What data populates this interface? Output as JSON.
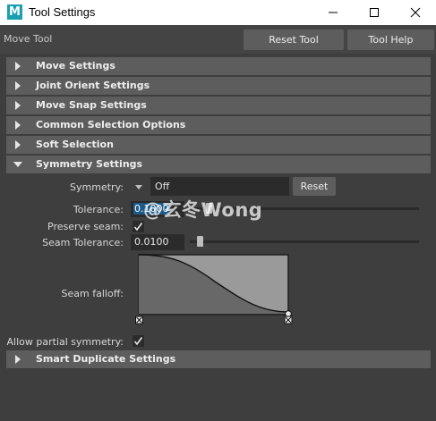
{
  "window": {
    "app_icon": "M",
    "title": "Tool Settings",
    "controls": [
      "minimize-icon",
      "maximize-icon",
      "close-icon"
    ]
  },
  "toolbar": {
    "tool_name": "Move Tool",
    "reset_label": "Reset Tool",
    "help_label": "Tool Help"
  },
  "sections": {
    "move_settings": "Move Settings",
    "joint_orient": "Joint Orient Settings",
    "move_snap": "Move Snap Settings",
    "common_selection": "Common Selection Options",
    "soft_selection": "Soft Selection",
    "symmetry": "Symmetry Settings",
    "smart_duplicate": "Smart Duplicate Settings"
  },
  "symmetry": {
    "symmetry_label": "Symmetry:",
    "symmetry_value": "Off",
    "reset_label": "Reset",
    "tolerance_label": "Tolerance:",
    "tolerance_value": "0.1000",
    "tolerance_slider_fraction": 0.07,
    "preserve_seam_label": "Preserve seam:",
    "preserve_seam_checked": true,
    "seam_tolerance_label": "Seam Tolerance:",
    "seam_tolerance_value": "0.0100",
    "seam_tolerance_slider_fraction": 0.03,
    "seam_falloff_label": "Seam falloff:",
    "allow_partial_label": "Allow partial symmetry:",
    "allow_partial_checked": true
  },
  "watermark": "@玄冬Wong",
  "colors": {
    "panel_bg": "#444444",
    "section_header": "#5d5d5d",
    "selection_blue": "#1e5a88",
    "graph_fill": "#686868",
    "graph_bg": "#9a9a9a"
  }
}
